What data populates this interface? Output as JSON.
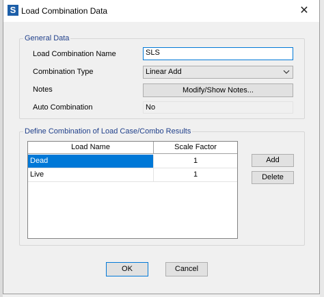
{
  "window": {
    "title": "Load Combination Data",
    "app_icon_letter": "S",
    "close_glyph": "✕"
  },
  "general_data": {
    "legend": "General Data",
    "name_label": "Load Combination Name",
    "name_value": "SLS",
    "type_label": "Combination Type",
    "type_value": "Linear Add",
    "notes_label": "Notes",
    "notes_button": "Modify/Show Notes...",
    "auto_label": "Auto Combination",
    "auto_value": "No"
  },
  "combination": {
    "legend": "Define Combination of Load Case/Combo Results",
    "columns": [
      "Load Name",
      "Scale Factor"
    ],
    "rows": [
      {
        "name": "Dead",
        "factor": "1",
        "selected": true
      },
      {
        "name": "Live",
        "factor": "1",
        "selected": false
      }
    ],
    "add_button": "Add",
    "delete_button": "Delete"
  },
  "footer": {
    "ok_button": "OK",
    "cancel_button": "Cancel"
  },
  "colors": {
    "accent": "#0078d7",
    "legend_text": "#1f3f8a",
    "app_icon": "#1c5ea8"
  },
  "icons": {
    "close": "close-icon",
    "dropdown": "chevron-down-icon",
    "app": "app-logo-icon"
  }
}
